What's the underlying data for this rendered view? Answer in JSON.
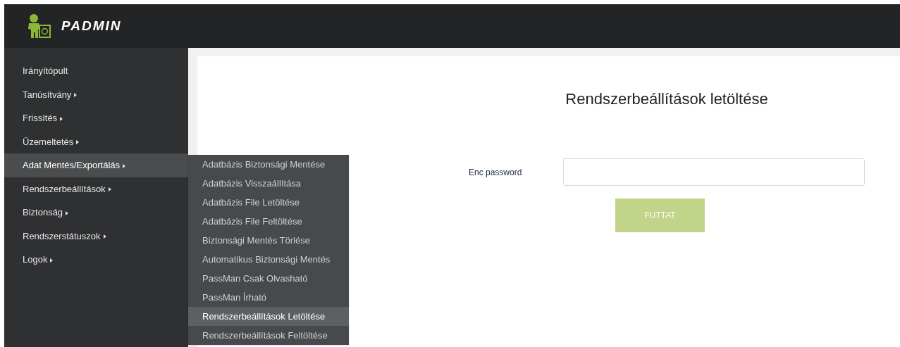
{
  "header": {
    "logo_text": "PADMIN"
  },
  "sidebar": {
    "items": [
      {
        "label": "Irányítópult",
        "has_submenu": false,
        "selected": false
      },
      {
        "label": "Tanúsítvány",
        "has_submenu": true,
        "selected": false
      },
      {
        "label": "Frissítés",
        "has_submenu": true,
        "selected": false
      },
      {
        "label": "Üzemeltetés",
        "has_submenu": true,
        "selected": false
      },
      {
        "label": "Adat Mentés/Exportálás",
        "has_submenu": true,
        "selected": true
      },
      {
        "label": "Rendszerbeállítások",
        "has_submenu": true,
        "selected": false
      },
      {
        "label": "Biztonság",
        "has_submenu": true,
        "selected": false
      },
      {
        "label": "Rendszerstátuszok",
        "has_submenu": true,
        "selected": false
      },
      {
        "label": "Logok",
        "has_submenu": true,
        "selected": false
      }
    ]
  },
  "submenu": {
    "items": [
      {
        "label": "Adatbázis Biztonsági Mentése",
        "selected": false
      },
      {
        "label": "Adatbázis Visszaállítása",
        "selected": false
      },
      {
        "label": "Adatbázis File Letöltése",
        "selected": false
      },
      {
        "label": "Adatbázis File Feltöltése",
        "selected": false
      },
      {
        "label": "Biztonsági Mentés Törlése",
        "selected": false
      },
      {
        "label": "Automatikus Biztonsági Mentés",
        "selected": false
      },
      {
        "label": "PassMan Csak Olvasható",
        "selected": false
      },
      {
        "label": "PassMan Írható",
        "selected": false
      },
      {
        "label": "Rendszerbeállítások Letöltése",
        "selected": true
      },
      {
        "label": "Rendszerbeállítások Feltöltése",
        "selected": false
      }
    ]
  },
  "main": {
    "title": "Rendszerbeállítások letöltése",
    "field_label": "Enc password",
    "run_button": "FUTTAT"
  }
}
